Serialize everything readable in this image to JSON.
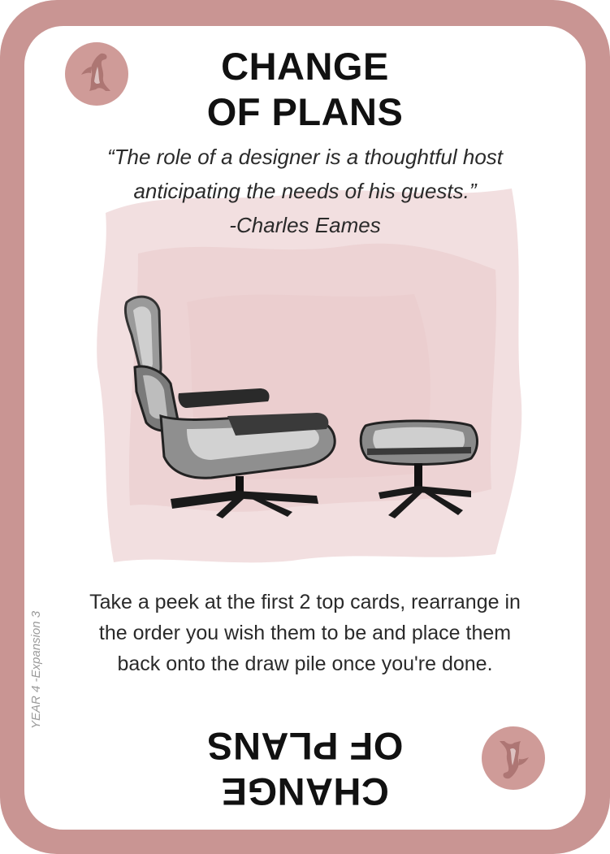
{
  "card": {
    "title_lines": [
      "CHANGE",
      "OF PLANS"
    ],
    "quote_lines": [
      "“The role of a designer is a thoughtful host",
      "anticipating the needs of his guests.”",
      "-Charles Eames"
    ],
    "description_lines": [
      "Take a peek at the first 2 top cards, rearrange in",
      "the order you wish them to be and place them",
      "back onto the draw pile once you're done."
    ],
    "side_label": "YEAR 4 -Expansion 3",
    "emblem_icon": "penguin-silhouette-icon",
    "illustration": "lounge-chair-and-ottoman",
    "colors": {
      "frame": "#c99593",
      "emblem": "#cf9b98",
      "wash": "#e7c5c6",
      "text": "#111111"
    }
  }
}
